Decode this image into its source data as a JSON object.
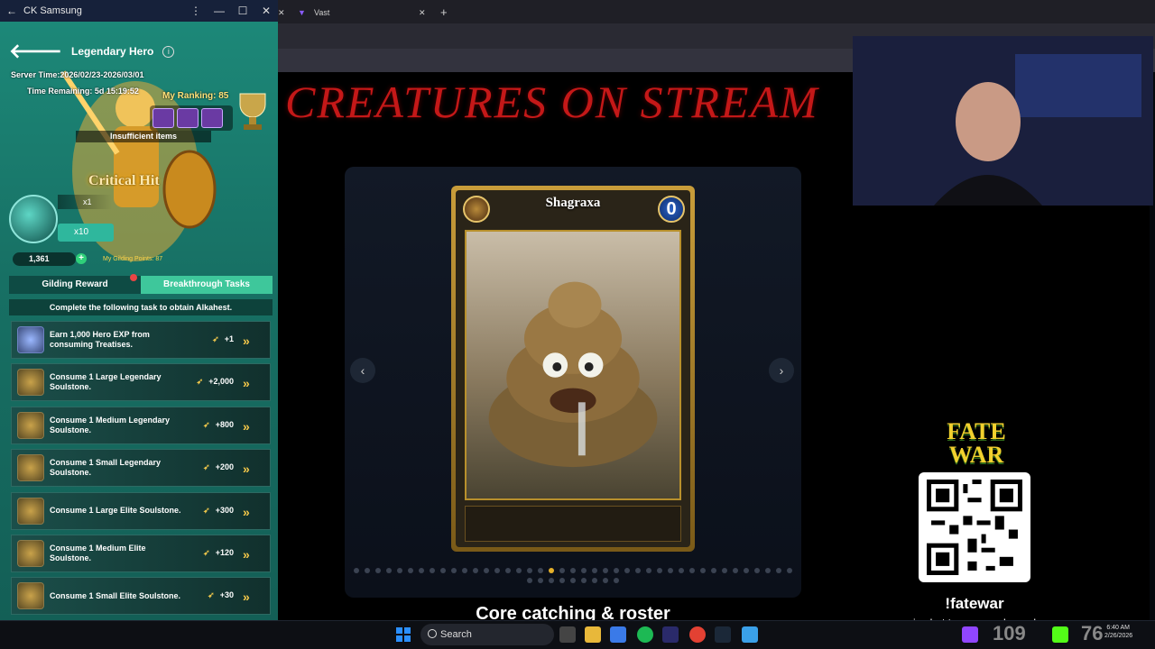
{
  "left_window": {
    "title": "CK Samsung",
    "header_title": "Legendary Hero",
    "server_time": "Server Time:2026/02/23-2026/03/01",
    "time_remaining": "Time Remaining: 5d 15:19:52",
    "my_ranking": "My Ranking: 85",
    "insufficient": "Insufficient items",
    "critical": "Critical Hit",
    "x1": "x1",
    "x10": "x10",
    "currency": "1,361",
    "gilding_points": "My Gilding Points: 87",
    "tabs": [
      "Gilding Reward",
      "Breakthrough Tasks"
    ],
    "task_hint": "Complete the following task to obtain Alkahest.",
    "tasks": [
      {
        "text": "Earn 1,000 Hero EXP from consuming Treatises.",
        "reward": "+1"
      },
      {
        "text": "Consume 1 Large Legendary Soulstone.",
        "reward": "+2,000"
      },
      {
        "text": "Consume 1 Medium Legendary Soulstone.",
        "reward": "+800"
      },
      {
        "text": "Consume 1 Small Legendary Soulstone.",
        "reward": "+200"
      },
      {
        "text": "Consume 1 Large Elite Soulstone.",
        "reward": "+300"
      },
      {
        "text": "Consume 1 Medium Elite Soulstone.",
        "reward": "+120"
      },
      {
        "text": "Consume 1 Small Elite Soulstone.",
        "reward": "+30"
      }
    ]
  },
  "browser": {
    "tab2": "Vast",
    "stream_title": "CREATURES ON STREAM",
    "card_name": "Shagraxa",
    "card_cost": "0",
    "prev": "‹",
    "next": "›",
    "section_heading": "Core catching & roster",
    "dots_active_index": 18
  },
  "promo": {
    "logo": "FATE WAR",
    "command": "!fatewar",
    "text": "in chat to see my channel"
  },
  "taskbar": {
    "search": "Search",
    "count1": "109",
    "count2": "76",
    "time": "6:40 AM",
    "date": "2/26/2026"
  }
}
